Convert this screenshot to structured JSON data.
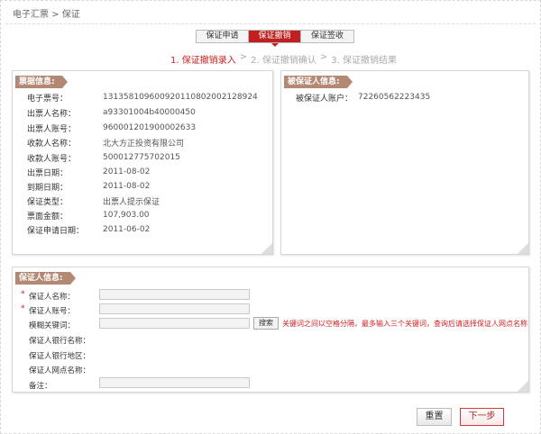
{
  "breadcrumb": "电子汇票 > 保证",
  "tabs": [
    "保证申请",
    "保证撤销",
    "保证签收"
  ],
  "steps": [
    "1. 保证撤销录入",
    ">",
    "2. 保证撤销确认",
    ">",
    "3. 保证撤销结果"
  ],
  "bill_panel": {
    "title": "票据信息:",
    "rows": [
      {
        "label": "电子票号：",
        "value": "131358109600920110802002128924"
      },
      {
        "label": "出票人名称：",
        "value": "a93301004b40000450"
      },
      {
        "label": "出票人账号：",
        "value": "960001201900002633"
      },
      {
        "label": "收款人名称：",
        "value": "北大方正投资有限公司"
      },
      {
        "label": "收款人账号：",
        "value": "500012775702015"
      },
      {
        "label": "出票日期：",
        "value": "2011-08-02"
      },
      {
        "label": "到期日期：",
        "value": "2011-08-02"
      },
      {
        "label": "保证类型：",
        "value": "出票人提示保证"
      },
      {
        "label": "票面金额：",
        "value": "107,903.00"
      },
      {
        "label": "保证申请日期：",
        "value": "2011-06-02"
      }
    ]
  },
  "guaranteed_panel": {
    "title": "被保证人信息:",
    "account_label": "被保证人账户：",
    "account_value": "72260562223435"
  },
  "guarantor_panel": {
    "title": "保证人信息:",
    "name_label": "保证人名称：",
    "account_label": "保证人账号：",
    "keyword_label": "模糊关键词：",
    "bank_name_label": "保证人银行名称：",
    "bank_region_label": "保证人银行地区：",
    "branch_label": "保证人网点名称：",
    "remark_label": "备注：",
    "required_mark": "*",
    "search_button": "搜索",
    "hint": "关键词之间以空格分隔，最多输入三个关键词，查询后请选择保证人网点名称"
  },
  "buttons": {
    "reset": "重置",
    "next": "下一步"
  },
  "colors": {
    "accent": "#c0201f",
    "panel_title": "#b48974"
  }
}
